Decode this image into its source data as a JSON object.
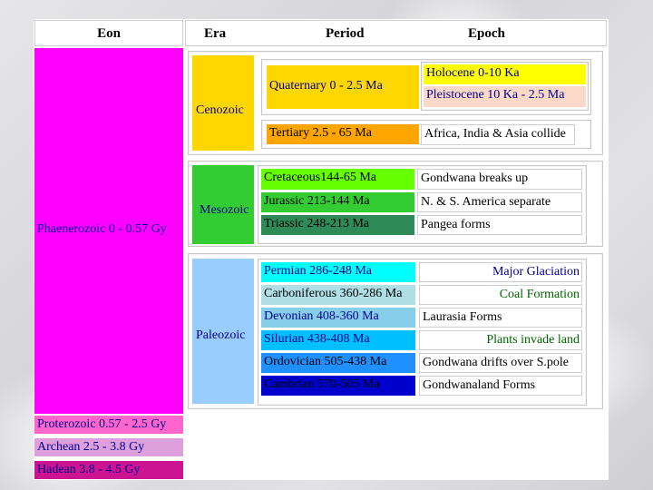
{
  "headers": {
    "eon": "Eon",
    "era": "Era",
    "period": "Period",
    "epoch": "Epoch"
  },
  "eons": {
    "phanerozoic": "Phaenerozoic 0 - 0.57 Gy",
    "proterozoic": "Proterozoic 0.57 - 2.5 Gy",
    "archean": "Archean 2.5 - 3.8 Gy",
    "hadean": "Hadean 3.8 - 4.5 Gy"
  },
  "eras": {
    "cenozoic": "Cenozoic",
    "mesozoic": "Mesozoic",
    "paleozoic": "Paleozoic"
  },
  "cenozoic": {
    "quaternary": "Quaternary 0 - 2.5 Ma",
    "holocene": "Holocene 0-10 Ka",
    "pleistocene": "Pleistocene 10 Ka - 2.5 Ma",
    "tertiary": "Tertiary 2.5 - 65 Ma",
    "tertiary_epoch": "Africa, India & Asia collide"
  },
  "mesozoic": [
    {
      "period": "Cretaceous144-65 Ma",
      "epoch": "Gondwana breaks up"
    },
    {
      "period": "Jurassic 213-144 Ma",
      "epoch": "N. & S. America separate"
    },
    {
      "period": "Triassic 248-213 Ma",
      "epoch": "Pangea forms"
    }
  ],
  "paleozoic": [
    {
      "period": "Permian 286-248 Ma",
      "epoch": "Major Glaciation"
    },
    {
      "period": "Carboniferous 360-286 Ma",
      "epoch": "Coal Formation"
    },
    {
      "period": "Devonian 408-360 Ma",
      "epoch": "Laurasia Forms"
    },
    {
      "period": "Silurian 438-408 Ma",
      "epoch": "Plants invade land"
    },
    {
      "period": "Ordovician 505-438 Ma",
      "epoch": "Gondwana drifts over S.pole"
    },
    {
      "period": "Cambrian 570-505 Ma",
      "epoch": "Gondwanaland Forms"
    }
  ],
  "colors": {
    "phanerozoic": "#ff00ff",
    "proterozoic": "#ff66cc",
    "archean": "#dda0dd",
    "hadean": "#cc1493",
    "cenozoic": "#ffd700",
    "holocene": "#ffff00",
    "pleistocene": "#fbd8c8",
    "tertiary": "#ffa500",
    "mesozoic": "#33cc33",
    "cretaceous": "#66ff00",
    "jurassic": "#33cc33",
    "triassic": "#2e8b57",
    "paleozoic": "#99ccff",
    "permian": "#00ffff",
    "carboniferous": "#b0e0e6",
    "devonian": "#87ceeb",
    "silurian": "#00bfff",
    "ordovician": "#1e90ff",
    "cambrian": "#0000cd",
    "text_blue": "#00008b",
    "text_green": "#006400"
  }
}
